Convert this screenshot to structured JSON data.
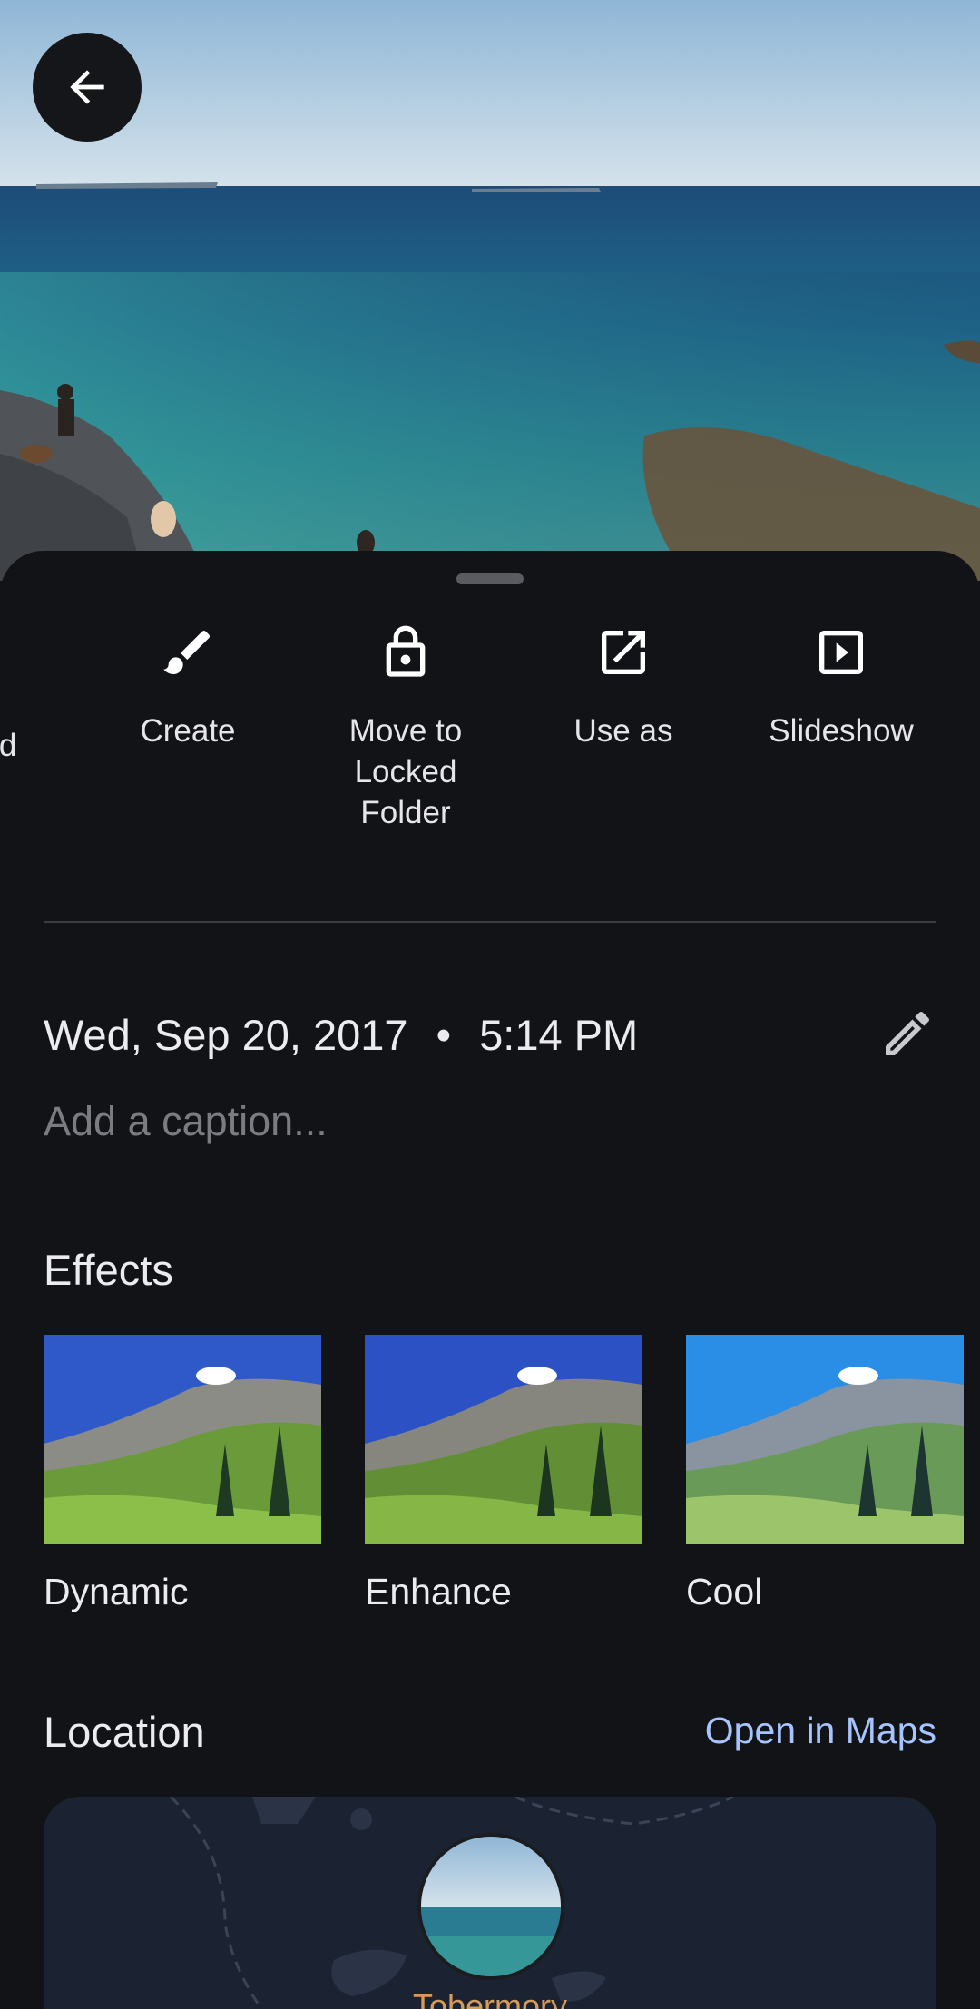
{
  "actions": {
    "partial_label": "oad",
    "items": [
      {
        "label": "Create",
        "icon": "brush-icon"
      },
      {
        "label": "Move to\nLocked\nFolder",
        "icon": "lock-icon"
      },
      {
        "label": "Use as",
        "icon": "open-external-icon"
      },
      {
        "label": "Slideshow",
        "icon": "slideshow-icon"
      }
    ]
  },
  "details": {
    "date": "Wed, Sep 20, 2017",
    "separator": "•",
    "time": "5:14 PM",
    "caption_placeholder": "Add a caption..."
  },
  "effects": {
    "title": "Effects",
    "items": [
      {
        "label": "Dynamic",
        "sky": "#2f59c9"
      },
      {
        "label": "Enhance",
        "sky": "#2b51c4"
      },
      {
        "label": "Cool",
        "sky": "#2a8ee6"
      }
    ]
  },
  "location": {
    "title": "Location",
    "open_maps": "Open in Maps",
    "place": "Tobermory"
  },
  "colors": {
    "background": "#121317",
    "accent_link": "#a8c4ff",
    "place_label": "#d89a5a"
  }
}
